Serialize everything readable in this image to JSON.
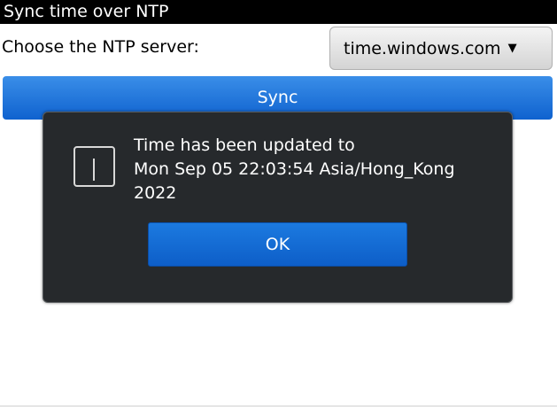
{
  "header": {
    "title": "Sync time over NTP"
  },
  "server": {
    "label": "Choose the NTP server:",
    "selected": "time.windows.com",
    "caret": "▼"
  },
  "sync_button": {
    "label": "Sync"
  },
  "dialog": {
    "lines": [
      "Time has been updated to",
      "Mon Sep 05 22:03:54 Asia/Hong_Kong",
      "2022"
    ],
    "icon": "info-icon",
    "ok_label": "OK"
  }
}
